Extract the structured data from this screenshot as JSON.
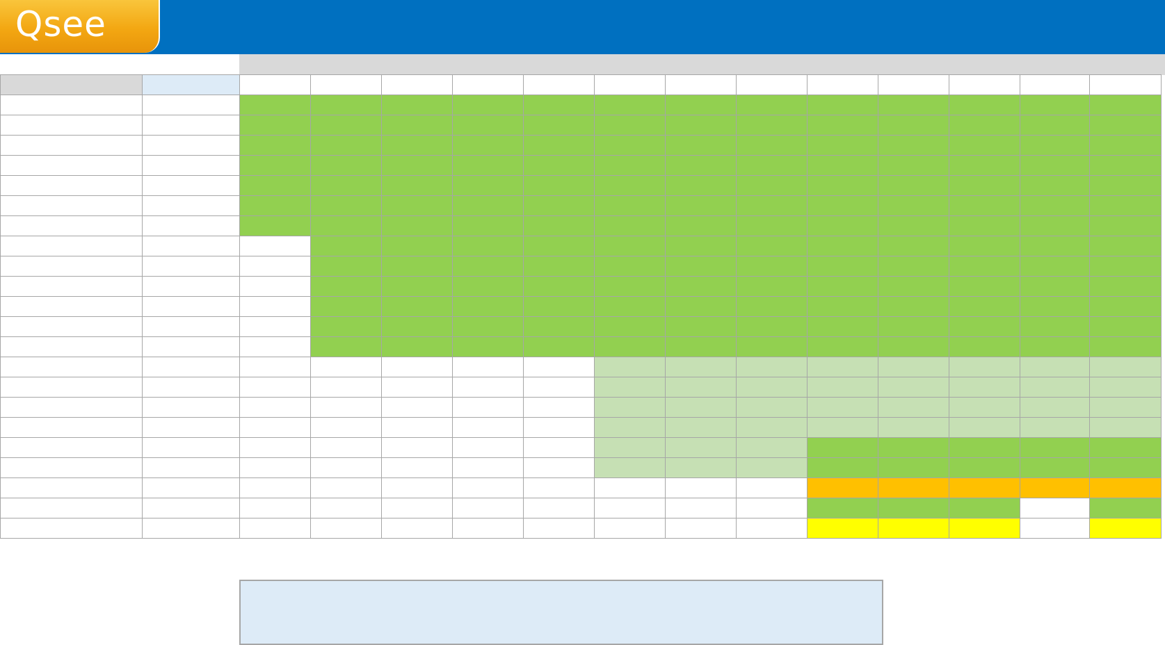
{
  "header": {
    "logo_text": "Qsee",
    "bar_color": "#0070c0",
    "logo_colors": [
      "#f9c53c",
      "#e8940a"
    ]
  },
  "palette": {
    "W": "#ffffff",
    "G": "#92d050",
    "L": "#c6e0b4",
    "O": "#ffc000",
    "Y": "#ffff00",
    "B": "#ddebf7",
    "X": "#d9d9d9"
  },
  "grid": {
    "rows": [
      "XBWWWWWWWWWWWWW",
      "WWGGGGGGGGGGGGG",
      "WWGGGGGGGGGGGGG",
      "WWGGGGGGGGGGGGG",
      "WWGGGGGGGGGGGGG",
      "WWGGGGGGGGGGGGG",
      "WWGGGGGGGGGGGGG",
      "WWGGGGGGGGGGGGG",
      "WWWGGGGGGGGGGGG",
      "WWWGGGGGGGGGGGG",
      "WWWGGGGGGGGGGGG",
      "WWWGGGGGGGGGGGG",
      "WWWGGGGGGGGGGGG",
      "WWWGGGGGGGGGGGG",
      "WWWWWWWLLLLLLLL",
      "WWWWWWWLLLLLLLL",
      "WWWWWWWLLLLLLLL",
      "WWWWWWWLLLLLLLL",
      "WWWWWWWLLLGGGGG",
      "WWWWWWWLLLGGGGG",
      "WWWWWWWWWWOOOOO",
      "WWWWWWWWWWGGGWG",
      "WWWWWWWWWWYYYWY"
    ]
  },
  "footer_note": {
    "color": "#ddebf7"
  }
}
